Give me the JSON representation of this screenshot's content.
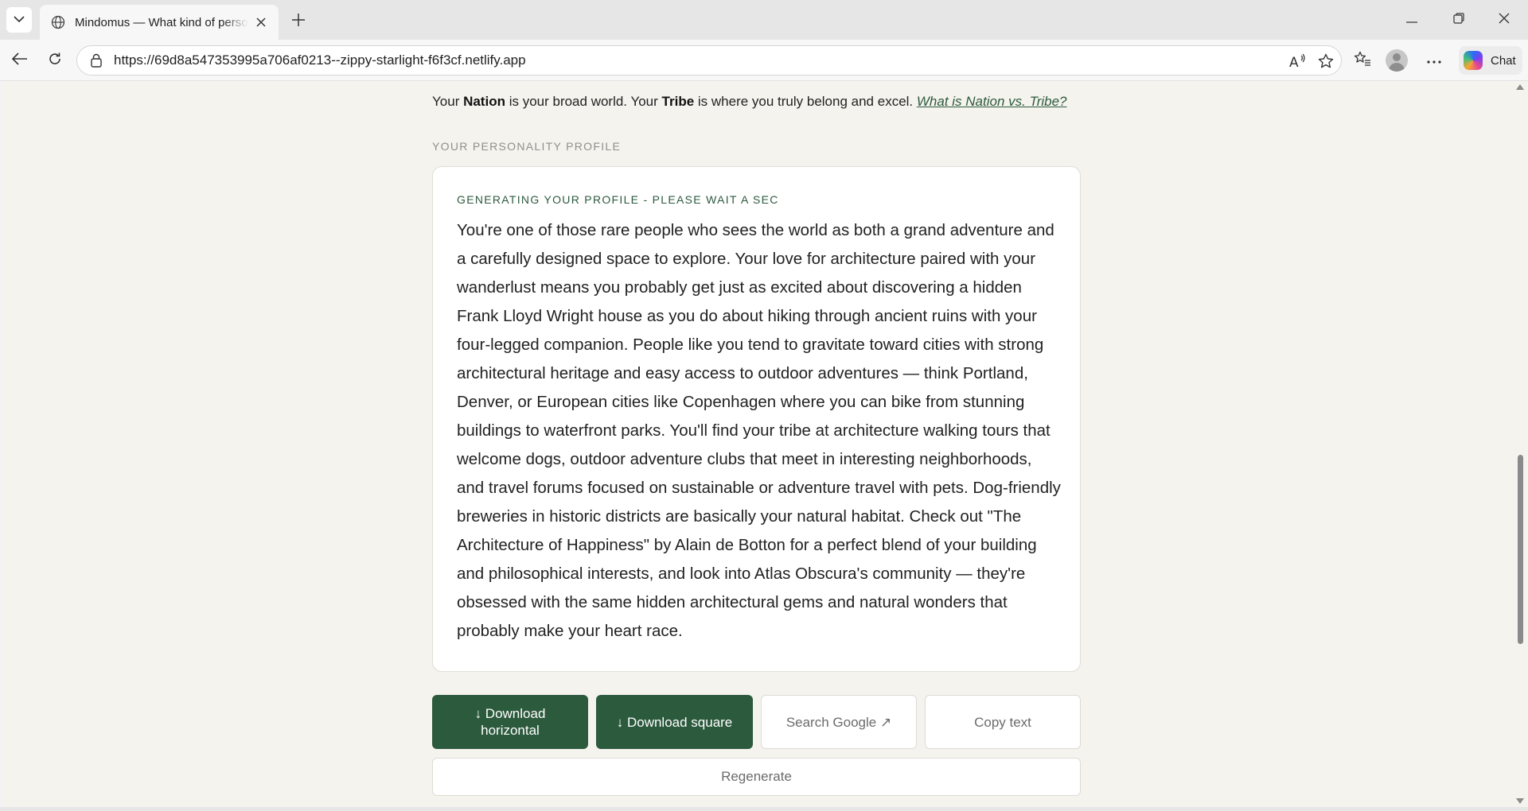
{
  "browser": {
    "tab_title": "Mindomus — What kind of person are you?",
    "url": "https://69d8a547353995a706af0213--zippy-starlight-f6f3cf.netlify.app",
    "chat_label": "Chat"
  },
  "page": {
    "nation_line": {
      "part1": "Your ",
      "nation": "Nation",
      "part2": " is your broad world. Your ",
      "tribe": "Tribe",
      "part3": " is where you truly belong and excel. ",
      "link": "What is Nation vs. Tribe?"
    },
    "section_label": "YOUR PERSONALITY PROFILE",
    "card": {
      "status": "GENERATING YOUR PROFILE - PLEASE WAIT A SEC",
      "text": "You're one of those rare people who sees the world as both a grand adventure and a carefully designed space to explore. Your love for architecture paired with your wanderlust means you probably get just as excited about discovering a hidden Frank Lloyd Wright house as you do about hiking through ancient ruins with your four-legged companion. People like you tend to gravitate toward cities with strong architectural heritage and easy access to outdoor adventures — think Portland, Denver, or European cities like Copenhagen where you can bike from stunning buildings to waterfront parks. You'll find your tribe at architecture walking tours that welcome dogs, outdoor adventure clubs that meet in interesting neighborhoods, and travel forums focused on sustainable or adventure travel with pets. Dog-friendly breweries in historic districts are basically your natural habitat. Check out \"The Architecture of Happiness\" by Alain de Botton for a perfect blend of your building and philosophical interests, and look into Atlas Obscura's community — they're obsessed with the same hidden architectural gems and natural wonders that probably make your heart race."
    },
    "buttons": {
      "download_horizontal_line1": "↓ Download",
      "download_horizontal_line2": "horizontal",
      "download_square": "↓ Download square",
      "search_google": "Search Google ↗",
      "copy_text": "Copy text",
      "regenerate": "Regenerate"
    }
  },
  "colors": {
    "accent_green": "#2c5a3d",
    "page_bg": "#f5f3ee",
    "card_bg": "#ffffff"
  },
  "icons": [
    "tab-list-icon",
    "globe-icon",
    "close-icon",
    "plus-icon",
    "minimize-icon",
    "restore-icon",
    "window-close-icon",
    "back-icon",
    "refresh-icon",
    "site-info-icon",
    "read-aloud-icon",
    "favorite-star-icon",
    "favorites-icon",
    "more-icon",
    "copilot-icon"
  ]
}
